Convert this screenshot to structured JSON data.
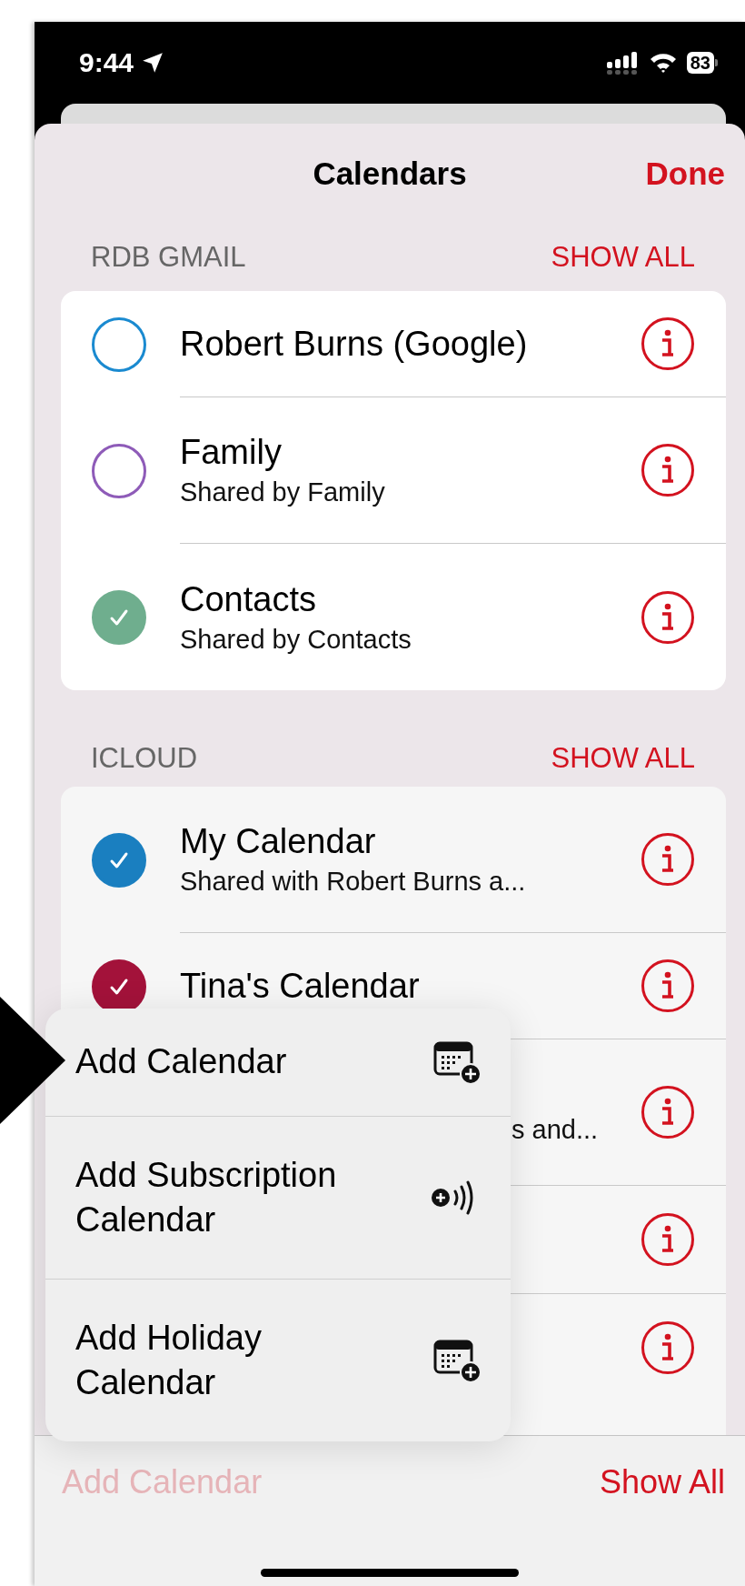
{
  "status_bar": {
    "time": "9:44",
    "battery": "83"
  },
  "header": {
    "title": "Calendars",
    "done": "Done"
  },
  "sections": [
    {
      "title": "RDB GMAIL",
      "action": "SHOW ALL",
      "calendars": [
        {
          "name": "Robert Burns (Google)",
          "checked": false,
          "color": "#1a8ad0",
          "kind": "calendar"
        },
        {
          "name": "Family",
          "subtitle": "Shared by Family",
          "checked": false,
          "color": "#8e5bb8",
          "kind": "calendar"
        },
        {
          "name": "Contacts",
          "subtitle": "Shared by Contacts",
          "checked": true,
          "color": "#6fae8e",
          "kind": "calendar"
        }
      ]
    },
    {
      "title": "ICLOUD",
      "action": "SHOW ALL",
      "calendars": [
        {
          "name": "My Calendar",
          "subtitle": "Shared with Robert Burns a...",
          "checked": true,
          "color": "#1a7fc0",
          "kind": "calendar"
        },
        {
          "name": "Tina's Calendar",
          "checked": true,
          "color": "#a3123a",
          "kind": "calendar"
        },
        {
          "partial": "s and...",
          "kind": "covered"
        },
        {
          "kind": "covered"
        },
        {
          "kind": "covered"
        }
      ]
    }
  ],
  "menu": [
    {
      "label": "Add Calendar",
      "kind": "calendar"
    },
    {
      "label": "Add Subscription Calendar",
      "kind": "subscription"
    },
    {
      "label": "Add Holiday Calendar",
      "kind": "calendar"
    }
  ],
  "toolbar": {
    "add": {
      "label": "Add Calendar",
      "disabled": true
    },
    "show_all": "Show All"
  }
}
